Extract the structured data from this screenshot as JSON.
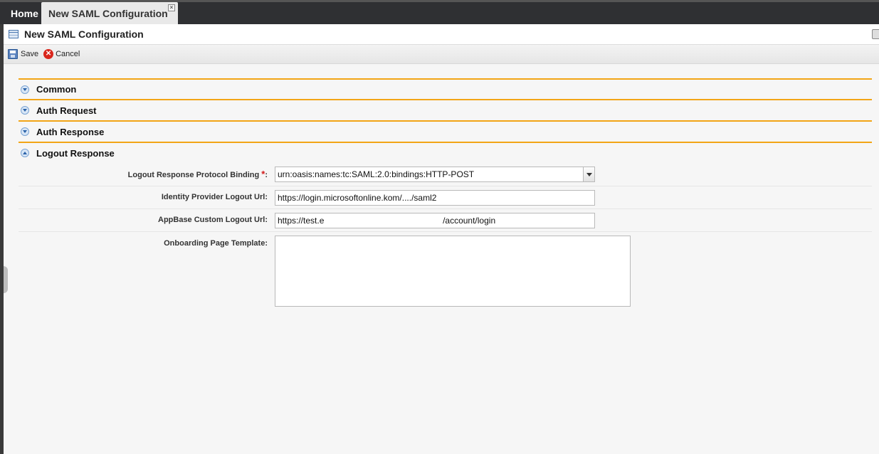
{
  "tabs": {
    "home": "Home",
    "active": "New SAML Configuration",
    "close": "×"
  },
  "page": {
    "title": "New SAML Configuration"
  },
  "toolbar": {
    "save_label": "Save",
    "cancel_label": "Cancel"
  },
  "sections": {
    "common": "Common",
    "auth_request": "Auth Request",
    "auth_response": "Auth Response",
    "logout_response": "Logout Response"
  },
  "logout_form": {
    "protocol_binding_label": "Logout Response Protocol Binding",
    "protocol_binding_required": "*",
    "protocol_binding_colon": ":",
    "protocol_binding_value": "urn:oasis:names:tc:SAML:2.0:bindings:HTTP-POST",
    "idp_logout_url_label": "Identity Provider Logout Url:",
    "idp_logout_url_value": "https://login.microsoftonline.kom/..../saml2",
    "appbase_logout_url_label": "AppBase Custom Logout Url:",
    "appbase_logout_url_value": "https://test.e                                                  /account/login",
    "onboarding_template_label": "Onboarding Page Template:",
    "onboarding_template_value": ""
  },
  "colors": {
    "section_border": "#f2a516",
    "topbar_bg": "#2f3033",
    "required_asterisk": "#d21b1b"
  },
  "icons": [
    "close-icon",
    "table-icon",
    "print-icon",
    "save-icon",
    "cancel-icon",
    "chevron-down-icon",
    "chevron-up-icon",
    "dropdown-arrow-icon"
  ]
}
